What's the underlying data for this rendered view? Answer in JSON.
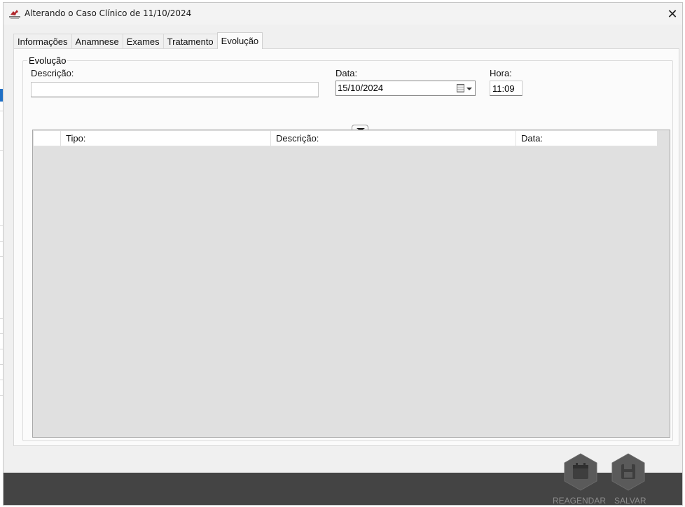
{
  "window": {
    "title": "Alterando o Caso Clínico de 11/10/2024",
    "close_glyph": "✕",
    "app_icon": "pet-shop-logo"
  },
  "tabs": [
    {
      "label": "Informações",
      "active": false
    },
    {
      "label": "Anamnese",
      "active": false
    },
    {
      "label": "Exames",
      "active": false
    },
    {
      "label": "Tratamento",
      "active": false
    },
    {
      "label": "Evolução",
      "active": true
    }
  ],
  "evolucao": {
    "group_label": "Evolução",
    "descricao_label": "Descrição:",
    "descricao_value": "",
    "data_label": "Data:",
    "data_value": "15/10/2024",
    "hora_label": "Hora:",
    "hora_value": "11:09"
  },
  "grid": {
    "columns": [
      "",
      "Tipo:",
      "Descrição:",
      "Data:"
    ],
    "rows": []
  },
  "actions": {
    "reagendar_label": "REAGENDAR",
    "salvar_label": "SALVAR"
  },
  "colors": {
    "footer": "#444444",
    "action_hex": "#5a5a5a",
    "action_text": "#8c8c8c"
  }
}
